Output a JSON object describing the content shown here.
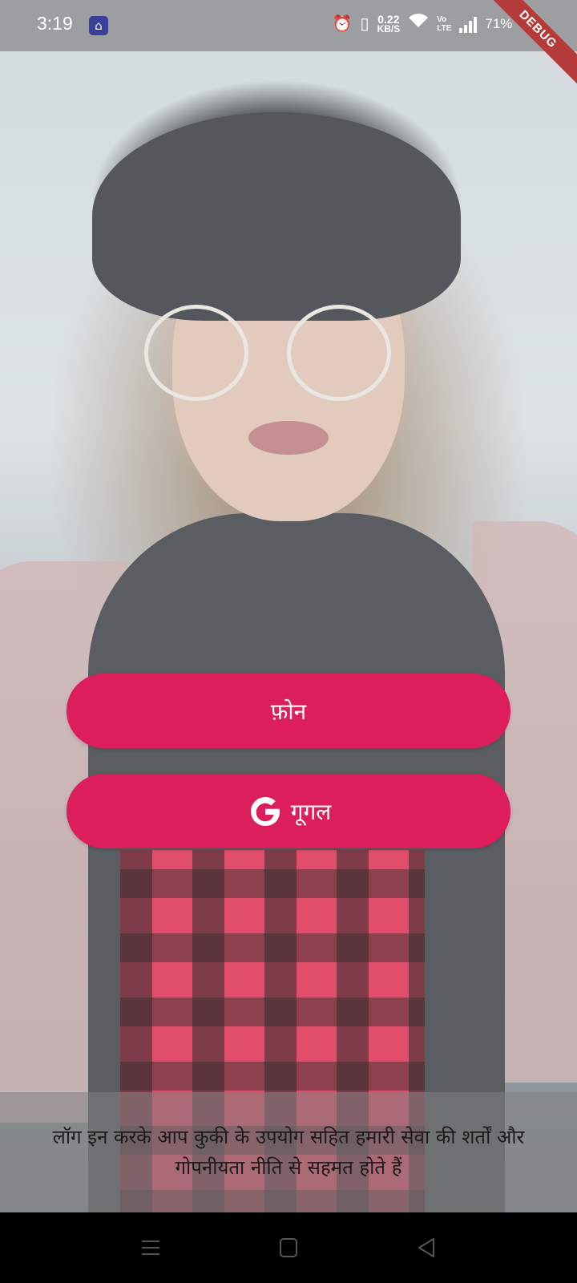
{
  "status_bar": {
    "time": "3:19",
    "network_speed": "0.22",
    "network_unit": "KB/S",
    "volte_top": "Vo",
    "volte_bottom": "LTE",
    "battery": "71%",
    "icons": [
      "app-icon",
      "alarm-icon",
      "vibrate-icon",
      "wifi-icon",
      "signal-icon",
      "charging-icon"
    ]
  },
  "debug_banner": "DEBUG",
  "buttons": {
    "phone_label": "फ़ोन",
    "google_label": "गूगल",
    "google_icon_letter": "G"
  },
  "terms": {
    "text": "लॉग इन करके आप कुकी के उपयोग सहित हमारी सेवा की शर्तों और गोपनीयता नीति से सहमत होते हैं"
  },
  "colors": {
    "accent": "#dc1e5a",
    "nav_bar": "#000000"
  },
  "nav_bar": {
    "icons": [
      "recent-apps-icon",
      "home-icon",
      "back-icon"
    ]
  }
}
